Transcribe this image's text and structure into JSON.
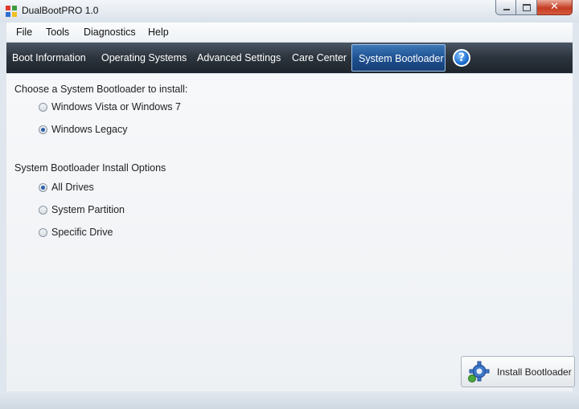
{
  "window": {
    "title": "DualBootPRO 1.0"
  },
  "menu": [
    "File",
    "Tools",
    "Diagnostics",
    "Help"
  ],
  "tabs": [
    {
      "label": "Boot Information",
      "active": false
    },
    {
      "label": "Operating Systems",
      "active": false
    },
    {
      "label": "Advanced Settings",
      "active": false
    },
    {
      "label": "Care Center",
      "active": false
    },
    {
      "label": "System Bootloader",
      "active": true
    }
  ],
  "help": {
    "label": "?"
  },
  "bootloader": {
    "heading": "Choose a System Bootloader to install:",
    "options": [
      {
        "label": "Windows Vista or Windows 7",
        "selected": false
      },
      {
        "label": "Windows Legacy",
        "selected": true
      }
    ]
  },
  "install_options": {
    "heading": "System Bootloader Install Options",
    "options": [
      {
        "label": "All Drives",
        "selected": true
      },
      {
        "label": "System Partition",
        "selected": false
      },
      {
        "label": "Specific Drive",
        "selected": false
      }
    ]
  },
  "actions": {
    "install_label": "Install Bootloader"
  },
  "colors": {
    "tab_bar": "#2b333c",
    "active_tab": "#1d4f8f",
    "radio_dot": "#2c5fa8"
  }
}
